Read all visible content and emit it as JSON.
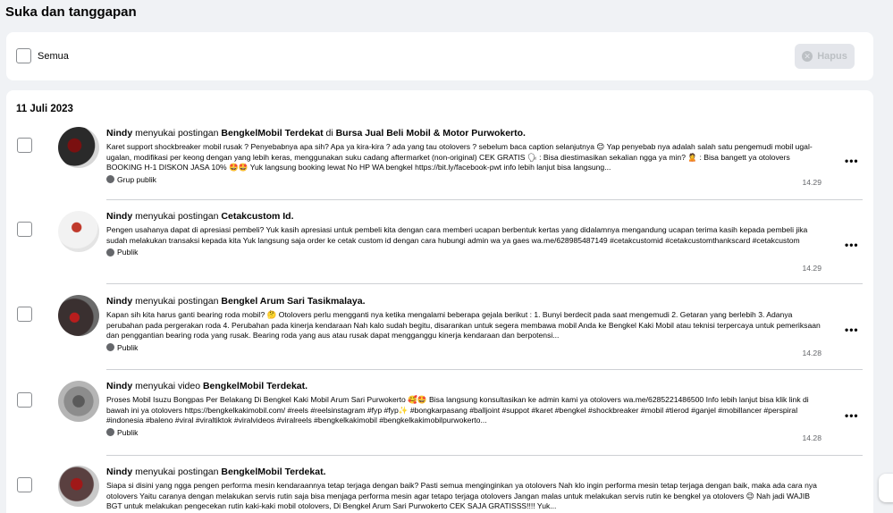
{
  "page": {
    "title": "Suka dan tanggapan"
  },
  "filter": {
    "select_all_label": "Semua",
    "delete_label": "Hapus"
  },
  "section": {
    "date": "11 Juli 2023"
  },
  "items": [
    {
      "actor": "Nindy",
      "verb": " menyukai postingan ",
      "target": "BengkelMobil Terdekat",
      "suffix_reg": " di ",
      "suffix_bold": "Bursa Jual Beli Mobil & Motor Purwokerto.",
      "text": "Karet support shockbreaker mobil rusak ? Penyebabnya apa sih? Apa ya kira-kira ? ada yang tau otolovers ? sebelum baca caption selanjutnya 😊 Yap penyebab nya adalah salah satu pengemudi mobil ugal-ugalan, modifikasi per keong dengan yang lebih keras, menggunakan suku cadang aftermarket (non-original) CEK GRATIS 🗣 : Bisa diestimasikan sekalian ngga ya min? 🙎 : Bisa bangett ya otolovers BOOKING H-1 DISKON JASA 10% 🤩🤩 Yuk langsung booking lewat No HP WA bengkel https://bit.ly/facebook-pwt info lebih lanjut bisa langsung...",
      "privacy": "Grup publik",
      "time": "14.29"
    },
    {
      "actor": "Nindy",
      "verb": " menyukai postingan ",
      "target": "Cetakcustom Id.",
      "suffix_reg": "",
      "suffix_bold": "",
      "text": "Pengen usahanya dapat di apresiasi pembeli? Yuk kasih apresiasi untuk pembeli kita dengan cara memberi ucapan berbentuk kertas yang didalamnya mengandung ucapan terima kasih kepada pembeli jika sudah melakukan transaksi kepada kita Yuk langsung saja order ke cetak custom id dengan cara hubungi admin wa ya gaes wa.me/628985487149 #cetakcustomid #cetakcustomthankscard #cetakcustom",
      "privacy": "Publik",
      "time": "14.29"
    },
    {
      "actor": "Nindy",
      "verb": " menyukai postingan ",
      "target": "Bengkel Arum Sari Tasikmalaya.",
      "suffix_reg": "",
      "suffix_bold": "",
      "text": "Kapan sih kita harus ganti bearing roda mobil? 🤔 Otolovers perlu mengganti nya ketika mengalami beberapa gejala berikut : 1. Bunyi berdecit pada saat mengemudi 2. Getaran yang berlebih 3. Adanya perubahan pada pergerakan roda 4. Perubahan pada kinerja kendaraan Nah kalo sudah begitu, disarankan untuk segera membawa mobil Anda ke Bengkel Kaki Mobil atau teknisi terpercaya untuk pemeriksaan dan penggantian bearing roda yang rusak. Bearing roda yang aus atau rusak dapat mengganggu kinerja kendaraan dan berpotensi...",
      "privacy": "Publik",
      "time": "14.28"
    },
    {
      "actor": "Nindy",
      "verb": " menyukai video ",
      "target": "BengkelMobil Terdekat.",
      "suffix_reg": "",
      "suffix_bold": "",
      "text": "Proses Mobil Isuzu Bongpas Per Belakang Di Bengkel Kaki Mobil Arum Sari Purwokerto 🥰🤩 Bisa langsung konsultasikan ke admin kami ya otolovers wa.me/6285221486500 Info lebih lanjut bisa klik link di bawah ini ya otolovers https://bengkelkakimobil.com/ #reels #reelsinstagram #fyp #fyp✨ #bongkarpasang #balljoint #suppot #karet #bengkel #shockbreaker #mobil #tierod #ganjel #mobillancer #perspiral #indonesia #baleno #viral #viraltiktok #viralvideos #viralreels #bengkelkakimobil #bengkelkakimobilpurwokerto...",
      "privacy": "Publik",
      "time": "14.28"
    },
    {
      "actor": "Nindy",
      "verb": " menyukai postingan ",
      "target": "BengkelMobil Terdekat.",
      "suffix_reg": "",
      "suffix_bold": "",
      "text": "Siapa si disini yang ngga pengen performa mesin kendaraannya tetap terjaga dengan baik? Pasti semua menginginkan ya otolovers Nah klo ingin performa mesin tetap terjaga dengan baik, maka ada cara nya otolovers Yaitu caranya dengan melakukan servis rutin saja bisa menjaga performa mesin agar tetapo terjaga otolovers Jangan malas untuk melakukan servis rutin ke bengkel ya otolovers 😉 Nah jadi WAJIB BGT untuk melakukan pengecekan rutin kaki-kaki mobil otolovers, Di Bengkel Arum Sari Purwokerto CEK SAJA GRATISSS!!!! Yuk...",
      "privacy": "",
      "time": ""
    }
  ],
  "colors": {
    "background": "#f0f2f5",
    "card": "#ffffff",
    "muted": "#65676b",
    "divider": "#ced0d4"
  },
  "icons": {
    "checkbox": "checkbox-icon",
    "delete": "x-circle-icon",
    "globe": "globe-icon",
    "more": "more-horizontal-icon"
  }
}
